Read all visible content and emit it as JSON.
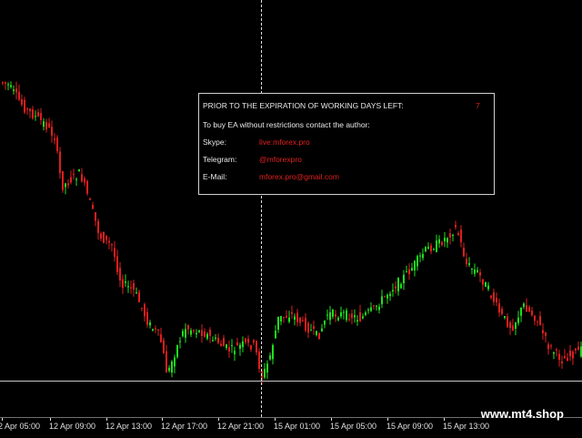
{
  "colors": {
    "background": "#000000",
    "bull_candle": "#1ee01e",
    "bear_candle": "#e01e1e",
    "crosshair": "#e0e0e0",
    "horizontal_line": "#c8c8c8",
    "panel_text": "#e8e8e8",
    "panel_accent": "#e02020"
  },
  "info_panel": {
    "expiration_label": "PRIOR TO THE EXPIRATION OF WORKING DAYS LEFT:",
    "days_left": "7",
    "contact_line": "To buy EA without restrictions contact the author:",
    "skype_label": "Skype:",
    "skype_value": "live:mforex.pro",
    "telegram_label": "Telegram:",
    "telegram_value": "@mforexpro",
    "email_label": "E-Mail:",
    "email_value": "mforex.pro@gmail.com"
  },
  "time_axis": {
    "labels": [
      "2 Apr 05:00",
      "12 Apr 09:00",
      "12 Apr 13:00",
      "12 Apr 17:00",
      "12 Apr 21:00",
      "15 Apr 01:00",
      "15 Apr 05:00",
      "15 Apr 09:00",
      "15 Apr 13:00"
    ]
  },
  "watermark": "www.mt4.shop"
}
